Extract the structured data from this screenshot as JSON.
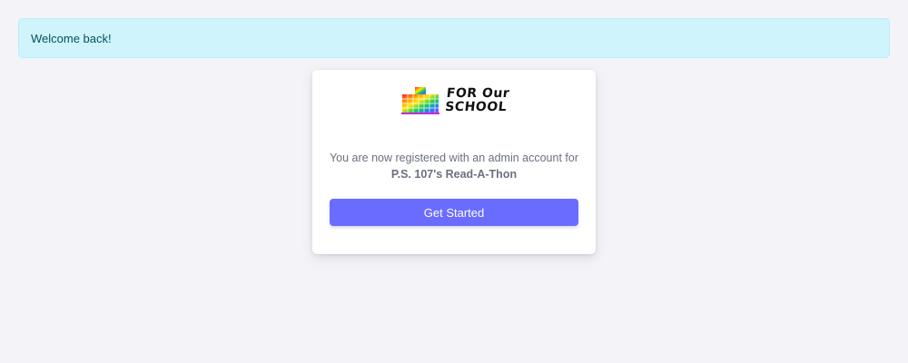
{
  "alert": {
    "message": "Welcome back!"
  },
  "card": {
    "logo": {
      "line1": "FOR Our",
      "line2": "SCHOOL"
    },
    "message_line1": "You are now registered with an admin account for",
    "organization": "P.S. 107's Read-A-Thon",
    "cta_label": "Get Started"
  },
  "colors": {
    "alert_bg": "#cff4fc",
    "button_bg": "#6a6cff",
    "page_bg": "#f4f4f8"
  }
}
